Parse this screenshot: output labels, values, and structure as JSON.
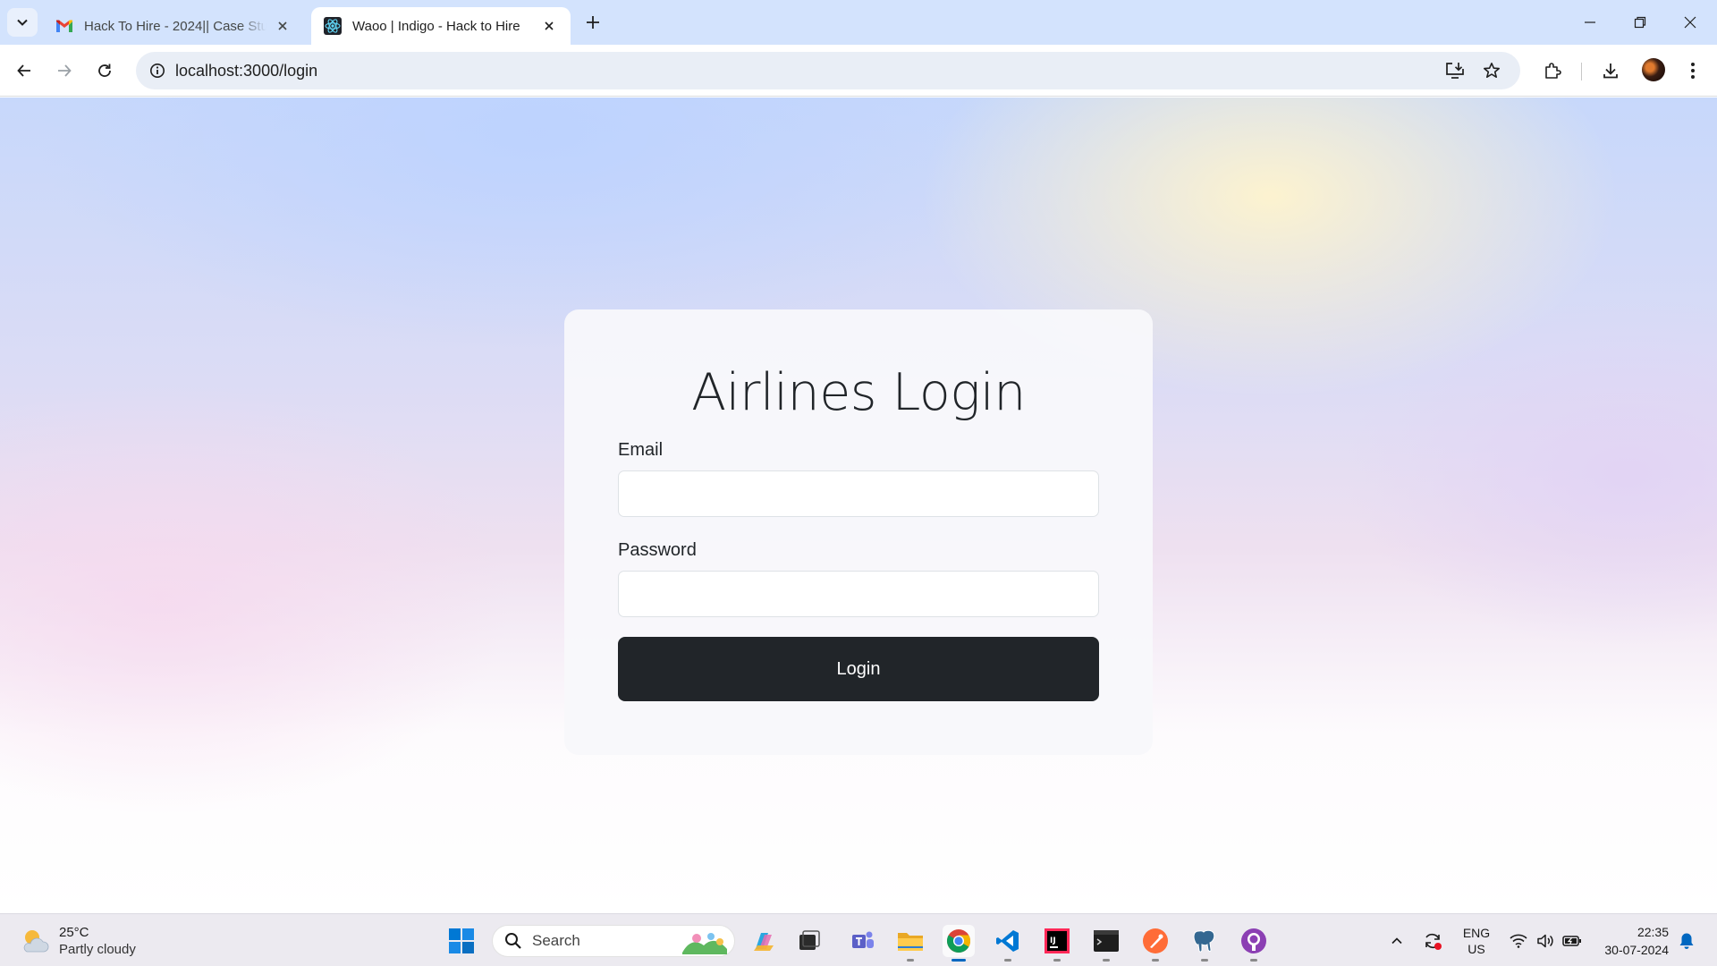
{
  "browser": {
    "tabs": [
      {
        "title": "Hack To Hire - 2024|| Case Stud",
        "favicon": "gmail-icon",
        "active": false
      },
      {
        "title": "Waoo | Indigo - Hack to Hire",
        "favicon": "react-icon",
        "active": true
      }
    ],
    "url": "localhost:3000/login"
  },
  "login": {
    "title": "Airlines Login",
    "email_label": "Email",
    "email_value": "",
    "password_label": "Password",
    "password_value": "",
    "button_label": "Login"
  },
  "taskbar": {
    "weather_temp": "25°C",
    "weather_desc": "Partly cloudy",
    "search_placeholder": "Search",
    "language": "ENG",
    "region": "US",
    "time": "22:35",
    "date": "30-07-2024"
  },
  "colors": {
    "tab_strip": "#d3e3fd",
    "button_dark": "#212529",
    "accent": "#0067c0"
  }
}
